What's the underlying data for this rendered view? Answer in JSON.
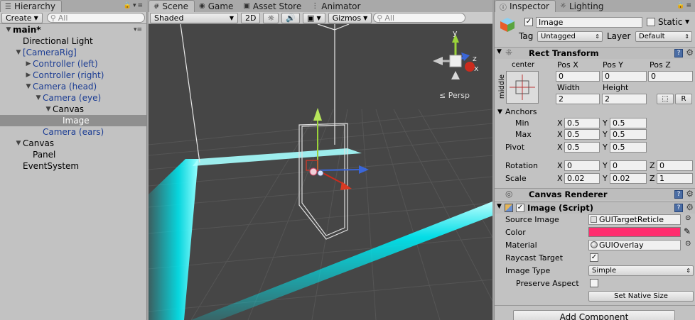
{
  "hierarchy": {
    "tab_label": "Hierarchy",
    "create_label": "Create",
    "search_placeholder": "All",
    "items": [
      {
        "label": "main*",
        "depth": 0,
        "arrow": "▼",
        "style": "bold"
      },
      {
        "label": "Directional Light",
        "depth": 1,
        "arrow": "",
        "style": ""
      },
      {
        "label": "[CameraRig]",
        "depth": 1,
        "arrow": "▼",
        "style": "blue"
      },
      {
        "label": "Controller (left)",
        "depth": 2,
        "arrow": "▶",
        "style": "blue"
      },
      {
        "label": "Controller (right)",
        "depth": 2,
        "arrow": "▶",
        "style": "blue"
      },
      {
        "label": "Camera (head)",
        "depth": 2,
        "arrow": "▼",
        "style": "blue"
      },
      {
        "label": "Camera (eye)",
        "depth": 3,
        "arrow": "▼",
        "style": "blue"
      },
      {
        "label": "Canvas",
        "depth": 4,
        "arrow": "▼",
        "style": ""
      },
      {
        "label": "Image",
        "depth": 5,
        "arrow": "",
        "style": "selected"
      },
      {
        "label": "Camera (ears)",
        "depth": 3,
        "arrow": "",
        "style": "blue"
      },
      {
        "label": "Canvas",
        "depth": 1,
        "arrow": "▼",
        "style": ""
      },
      {
        "label": "Panel",
        "depth": 2,
        "arrow": "",
        "style": ""
      },
      {
        "label": "EventSystem",
        "depth": 1,
        "arrow": "",
        "style": ""
      }
    ]
  },
  "scene": {
    "tabs": [
      {
        "label": "Scene",
        "icon": "scene-icon",
        "active": true
      },
      {
        "label": "Game",
        "icon": "game-icon",
        "active": false
      },
      {
        "label": "Asset Store",
        "icon": "asset-store-icon",
        "active": false
      },
      {
        "label": "Animator",
        "icon": "animator-icon",
        "active": false
      }
    ],
    "shading_mode": "Shaded",
    "mode_2d": "2D",
    "gizmos_label": "Gizmos",
    "search_placeholder": "All",
    "persp_label": "Persp",
    "gizmo_axes": {
      "y": "y",
      "x": "x",
      "z": "z"
    },
    "colors": {
      "background": "#464646",
      "glow": "#00e5ee",
      "x_axis": "#cc2b1d",
      "y_axis": "#9bd43a",
      "z_axis": "#3a66d8"
    }
  },
  "inspector": {
    "tabs": [
      {
        "label": "Inspector",
        "active": true
      },
      {
        "label": "Lighting",
        "active": false
      }
    ],
    "object_name": "Image",
    "static_label": "Static",
    "tag_label": "Tag",
    "tag_value": "Untagged",
    "layer_label": "Layer",
    "layer_value": "Default",
    "rect_transform": {
      "title": "Rect Transform",
      "anchor_h": "center",
      "anchor_v": "middle",
      "pos_x_label": "Pos X",
      "pos_x": "0",
      "pos_y_label": "Pos Y",
      "pos_y": "0",
      "pos_z_label": "Pos Z",
      "pos_z": "0",
      "width_label": "Width",
      "width": "2",
      "height_label": "Height",
      "height": "2",
      "r_button": "R",
      "anchors_label": "Anchors",
      "min_label": "Min",
      "min_x": "0.5",
      "min_y": "0.5",
      "max_label": "Max",
      "max_x": "0.5",
      "max_y": "0.5",
      "pivot_label": "Pivot",
      "pivot_x": "0.5",
      "pivot_y": "0.5",
      "rotation_label": "Rotation",
      "rot_x": "0",
      "rot_y": "0",
      "rot_z": "0",
      "scale_label": "Scale",
      "scale_x": "0.02",
      "scale_y": "0.02",
      "scale_z": "1",
      "axis_x": "X",
      "axis_y": "Y",
      "axis_z": "Z"
    },
    "canvas_renderer": {
      "title": "Canvas Renderer"
    },
    "image_script": {
      "title": "Image (Script)",
      "source_image_label": "Source Image",
      "source_image": "GUITargetReticle",
      "color_label": "Color",
      "color_value": "#ff2d6e",
      "material_label": "Material",
      "material": "GUIOverlay",
      "raycast_label": "Raycast Target",
      "raycast_checked": "✓",
      "image_type_label": "Image Type",
      "image_type": "Simple",
      "preserve_label": "Preserve Aspect",
      "native_size_button": "Set Native Size"
    },
    "add_component_button": "Add Component"
  }
}
